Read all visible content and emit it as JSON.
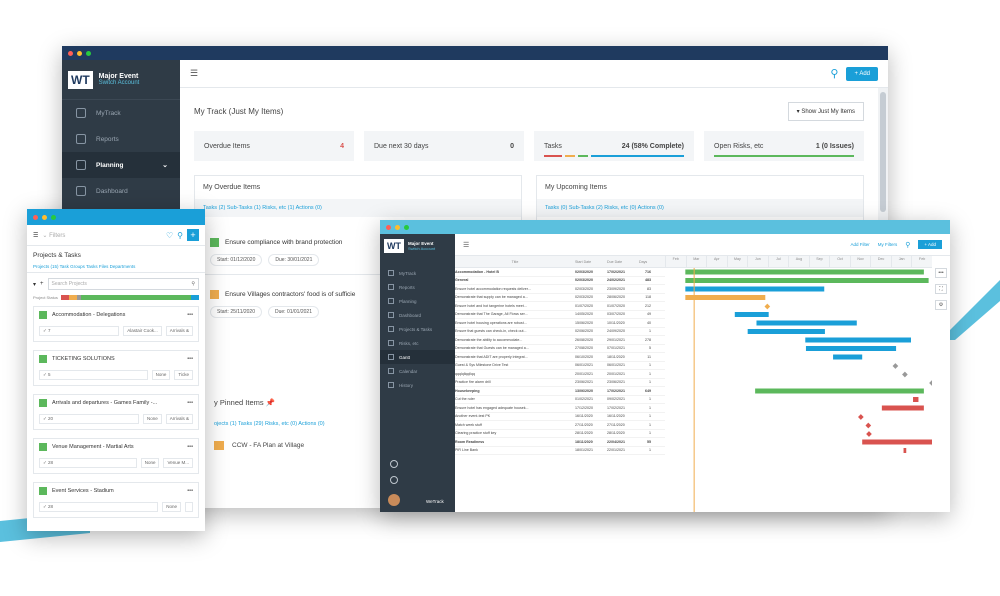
{
  "main": {
    "logo": "WT",
    "account_name": "Major Event",
    "account_switch": "Switch Account",
    "nav": [
      {
        "label": "MyTrack",
        "icon": "user-icon"
      },
      {
        "label": "Reports",
        "icon": "reports-icon"
      },
      {
        "label": "Planning",
        "icon": "planning-icon",
        "chevron": "⌄"
      },
      {
        "label": "Dashboard",
        "icon": "dashboard-icon"
      }
    ],
    "add_label": "+ Add",
    "track_title": "My Track (Just My Items)",
    "show_mine": "▾  Show Just My Items",
    "stats": [
      {
        "label": "Overdue Items",
        "value": "4"
      },
      {
        "label": "Due next 30 days",
        "value": "0"
      },
      {
        "label": "Tasks",
        "value": "24 (58% Complete)"
      },
      {
        "label": "Open Risks, etc",
        "value": "1 (0 Issues)"
      }
    ],
    "overdue_title": "My Overdue Items",
    "overdue_tabs": "Tasks (2)   Sub-Tasks (1)   Risks, etc (1)   Actions (0)",
    "upcoming_title": "My Upcoming Items",
    "upcoming_tabs": "Tasks (0)   Sub-Tasks (2)   Risks, etc (0)   Actions (0)",
    "pinned_title": "y Pinned Items",
    "pinned_tabs": "ojects (1)   Tasks (29)   Risks, etc (0)   Actions (0)",
    "pinned_item": "CCW - FA Plan at Village"
  },
  "tasks_popup": [
    {
      "label": "Ensure compliance with brand protection",
      "start": "Start: 01/12/2020",
      "due": "Due: 30/01/2021"
    },
    {
      "label": "Ensure Villages contractors' food is of sufficie",
      "start": "Start: 25/11/2020",
      "due": "Due: 01/01/2021"
    }
  ],
  "mobile": {
    "filter": "⌄  Filters",
    "heading": "Projects & Tasks",
    "tabs": "Projects (15)   Task Groups   Tasks   Files   Departments",
    "search_placeholder": "Search Projects",
    "status_label": "Project Status",
    "items": [
      {
        "title": "Accommodation - Delegations",
        "count": "✓ 7",
        "owner": "Alastair Cook...",
        "assigned": "Arrivals &"
      },
      {
        "title": "TICKETING SOLUTIONS",
        "count": "✓ 5",
        "owner": "None",
        "assigned": "Ticke"
      },
      {
        "title": "Arrivals and departures - Games Family -...",
        "count": "✓ 20",
        "owner": "None",
        "assigned": "Arrivals &"
      },
      {
        "title": "Venue Management - Martial Arts",
        "count": "✓ 28",
        "owner": "None",
        "assigned": "Venue M..."
      },
      {
        "title": "Event Services - Stadium",
        "count": "✓ 28",
        "owner": "None",
        "assigned": ""
      }
    ]
  },
  "gantt": {
    "logo": "WT",
    "account_name": "Major Event",
    "account_switch": "Switch Account",
    "nav": [
      "MyTrack",
      "Reports",
      "Planning",
      "Dashboard",
      "Projects & Tasks",
      "Risks, etc",
      "Gantt",
      "Calendar",
      "History"
    ],
    "org": "WeTrack",
    "top_actions": [
      "Add Filter",
      "My Filters"
    ],
    "add_label": "+ Add",
    "columns": [
      "Title",
      "Start Date",
      "Due Date",
      "Days"
    ],
    "months": [
      "Feb",
      "Mar",
      "Apr",
      "May",
      "Jun",
      "Jul",
      "Aug",
      "Sep",
      "Oct",
      "Nov",
      "Dec",
      "Jan",
      "Feb"
    ],
    "rows": [
      {
        "title": "Accommodation - Hotel B",
        "start": "02/03/2020",
        "due": "17/02/2021",
        "days": "716"
      },
      {
        "title": "General",
        "start": "02/03/2020",
        "due": "24/02/2021",
        "days": "483"
      },
      {
        "title": "Ensure hotel accommodation requests deliver...",
        "start": "02/03/2020",
        "due": "23/09/2020",
        "days": "83"
      },
      {
        "title": "Demonstrate that supply can be managed a...",
        "start": "02/03/2020",
        "due": "28/06/2020",
        "days": "118"
      },
      {
        "title": "Ensure hotel and hot tangerine hotels meet...",
        "start": "01/07/2020",
        "due": "01/07/2020",
        "days": "212"
      },
      {
        "title": "Demonstrate that The Garage, All Flows ser...",
        "start": "14/05/2020",
        "due": "03/07/2020",
        "days": "49"
      },
      {
        "title": "Ensure hotel housing operations are robust...",
        "start": "15/06/2020",
        "due": "10/11/2020",
        "days": "40"
      },
      {
        "title": "Ensure that guests can check-in, check out...",
        "start": "02/06/2020",
        "due": "24/09/2020",
        "days": "1"
      },
      {
        "title": "Demonstrate the ability to accommodate...",
        "start": "26/08/2020",
        "due": "29/01/2021",
        "days": "278"
      },
      {
        "title": "Demonstrate that Guests can be managed a...",
        "start": "27/08/2020",
        "due": "07/01/2021",
        "days": "5"
      },
      {
        "title": "Demonstrate that ADIT are properly integrat...",
        "start": "06/10/2020",
        "due": "18/11/2020",
        "days": "11"
      },
      {
        "title": "Guest & Sys Milestone Drive Test",
        "start": "06/01/2021",
        "due": "06/01/2021",
        "days": "1"
      },
      {
        "title": "qqqlqllqqllqq",
        "start": "20/01/2021",
        "due": "20/01/2021",
        "days": "1"
      },
      {
        "title": "Practice fire alarm drill",
        "start": "23/06/2021",
        "due": "23/06/2021",
        "days": "1"
      },
      {
        "title": "Housekeeping",
        "start": "13/06/2020",
        "due": "17/02/2021",
        "days": "649"
      },
      {
        "title": "Cut the ruler",
        "start": "01/02/2021",
        "due": "09/02/2021",
        "days": "1"
      },
      {
        "title": "Ensure hotel has engaged adequate housek...",
        "start": "17/12/2020",
        "due": "17/02/2021",
        "days": "1"
      },
      {
        "title": "Another event-test PK",
        "start": "16/11/2020",
        "due": "16/11/2020",
        "days": "1"
      },
      {
        "title": "Match week stuff",
        "start": "27/11/2020",
        "due": "27/11/2020",
        "days": "1"
      },
      {
        "title": "Clearing practice stuff key",
        "start": "28/11/2020",
        "due": "28/11/2020",
        "days": "1"
      },
      {
        "title": "Room Readiness",
        "start": "18/11/2020",
        "due": "22/04/2021",
        "days": "55"
      },
      {
        "title": "PIR Line Bank",
        "start": "18/01/2021",
        "due": "22/01/2021",
        "days": "1"
      }
    ]
  },
  "colors": {
    "accent": "#1a9fd8",
    "sidebar": "#2f3b46",
    "bar_green": "#5cb85c",
    "bar_blue": "#1a9fd8",
    "bar_orange": "#f0ad4e",
    "bar_red": "#d9534f"
  }
}
